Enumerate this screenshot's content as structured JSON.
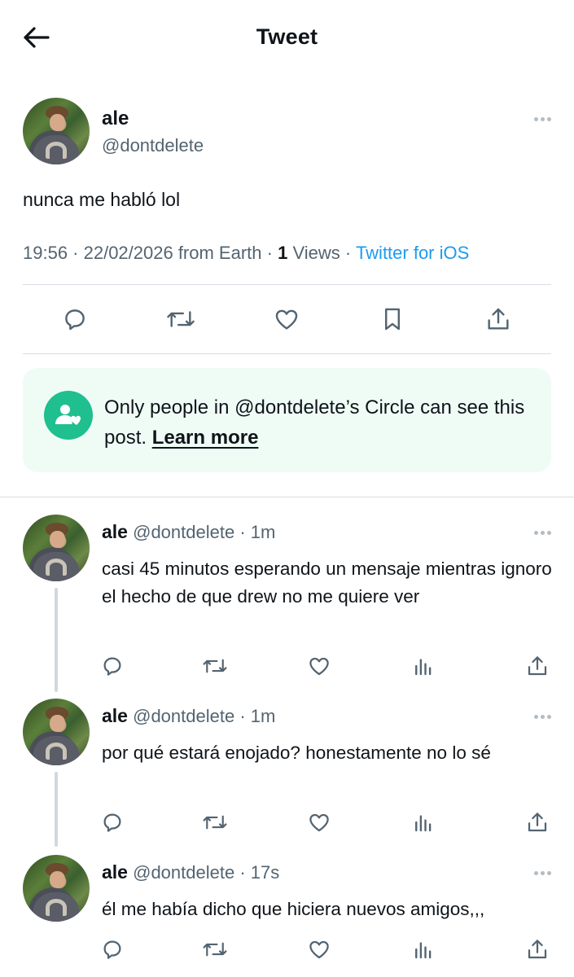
{
  "header": {
    "title": "Tweet",
    "back_icon": "arrow-left-icon"
  },
  "main_tweet": {
    "name": "ale",
    "handle": "@dontdelete",
    "text": "nunca me habló lol",
    "time": "19:56 · 22/02/2026 from Earth ·",
    "views_count": "1",
    "views_label": "Views",
    "separator": "·",
    "source": "Twitter for iOS",
    "actions": [
      "reply-icon",
      "retweet-icon",
      "like-icon",
      "bookmark-icon",
      "share-icon"
    ]
  },
  "circle_notice": {
    "text": "Only people in @dontdelete’s Circle can see this post.",
    "link": "Learn more",
    "icon": "circle-people-icon",
    "accent": "#1fbf8f",
    "background": "#effcf6"
  },
  "replies": [
    {
      "name": "ale",
      "handle": "@dontdelete",
      "time": "· 1m",
      "text": "casi 45 minutos esperando un mensaje mientras ignoro el hecho de que drew no me quiere ver"
    },
    {
      "name": "ale",
      "handle": "@dontdelete",
      "time": "· 1m",
      "text": "por qué estará enojado? honestamente no lo sé"
    },
    {
      "name": "ale",
      "handle": "@dontdelete",
      "time": "· 17s",
      "text": "él me había dicho que hiciera nuevos amigos,,,"
    }
  ],
  "colors": {
    "text_primary": "#0f1419",
    "text_secondary": "#536471",
    "link_blue": "#1d9bf0",
    "divider": "#d9dde1"
  }
}
